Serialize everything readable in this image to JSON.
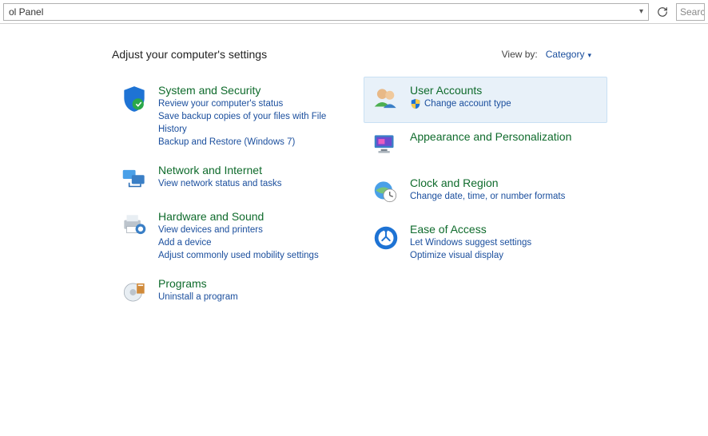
{
  "addressbar": {
    "path": "ol Panel",
    "searchPlaceholder": "Searc"
  },
  "header": {
    "title": "Adjust your computer's settings",
    "viewByLabel": "View by:",
    "viewByValue": "Category"
  },
  "left": [
    {
      "title": "System and Security",
      "links": [
        "Review your computer's status",
        "Save backup copies of your files with File History",
        "Backup and Restore (Windows 7)"
      ]
    },
    {
      "title": "Network and Internet",
      "links": [
        "View network status and tasks"
      ]
    },
    {
      "title": "Hardware and Sound",
      "links": [
        "View devices and printers",
        "Add a device",
        "Adjust commonly used mobility settings"
      ]
    },
    {
      "title": "Programs",
      "links": [
        "Uninstall a program"
      ]
    }
  ],
  "right": [
    {
      "title": "User Accounts",
      "shieldLink": "Change account type",
      "links": []
    },
    {
      "title": "Appearance and Personalization",
      "links": []
    },
    {
      "title": "Clock and Region",
      "links": [
        "Change date, time, or number formats"
      ]
    },
    {
      "title": "Ease of Access",
      "links": [
        "Let Windows suggest settings",
        "Optimize visual display"
      ]
    }
  ]
}
